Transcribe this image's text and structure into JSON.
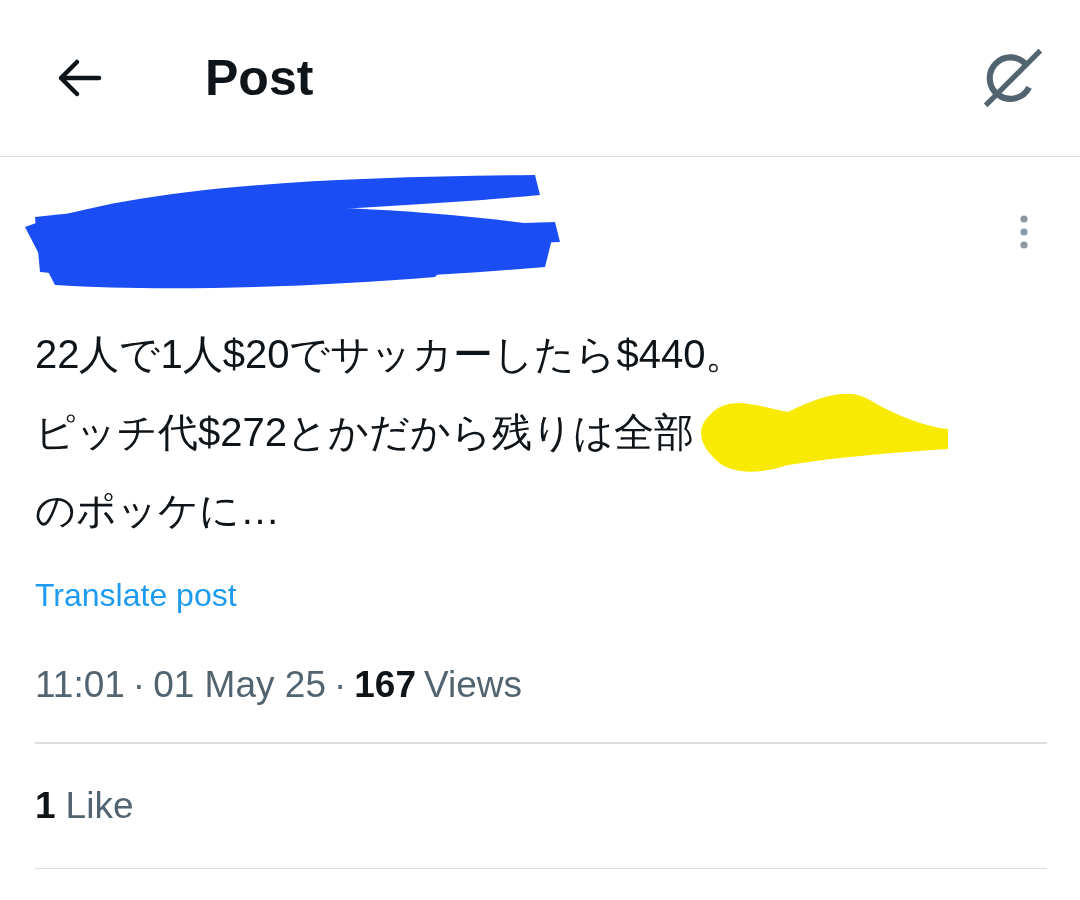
{
  "header": {
    "title": "Post"
  },
  "post": {
    "text_lines": [
      "22人で1人$20でサッカーしたら$440。",
      "ピッチ代$272とかだから残りは全部",
      "のポッケに…"
    ],
    "translate": "Translate post",
    "time": "11:01",
    "separator": "·",
    "date": "01 May 25",
    "views_count": "167",
    "views_label": "Views",
    "likes_count": "1",
    "likes_label": "Like"
  }
}
